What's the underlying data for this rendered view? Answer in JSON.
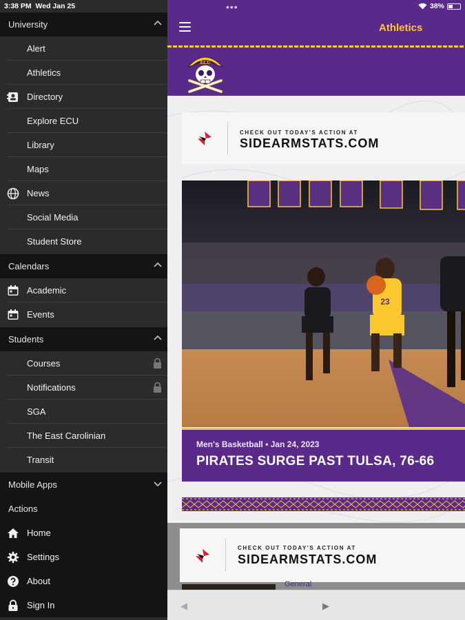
{
  "status": {
    "time": "3:38 PM",
    "date": "Wed Jan 25",
    "battery": "38%"
  },
  "sidebar": {
    "sections": [
      {
        "title": "University",
        "items": [
          "Alert",
          "Athletics",
          "Directory",
          "Explore ECU",
          "Library",
          "Maps",
          "News",
          "Social Media",
          "Student Store"
        ]
      },
      {
        "title": "Calendars",
        "items": [
          "Academic",
          "Events"
        ]
      },
      {
        "title": "Students",
        "items": [
          "Courses",
          "Notifications",
          "SGA",
          "The East Carolinian",
          "Transit"
        ]
      },
      {
        "title": "Mobile Apps"
      }
    ],
    "actions_title": "Actions",
    "actions": [
      "Home",
      "Settings",
      "About",
      "Sign In"
    ]
  },
  "header": {
    "title": "Athletics"
  },
  "promo": {
    "small": "CHECK OUT TODAY'S ACTION AT",
    "big": "SIDEARMSTATS.COM"
  },
  "story": {
    "meta": "Men's Basketball • Jan 24, 2023",
    "title": "PIRATES SURGE PAST TULSA, 76-66"
  },
  "logo": {
    "text": "ECU"
  },
  "peek": {
    "text": "General"
  },
  "photo": {
    "jersey": "23"
  },
  "nav": {
    "back": "◀",
    "forward": "▶"
  },
  "colors": {
    "purple": "#592a8a",
    "gold": "#fdc82f",
    "sidebar": "#2b2b2b",
    "section": "#141414"
  }
}
